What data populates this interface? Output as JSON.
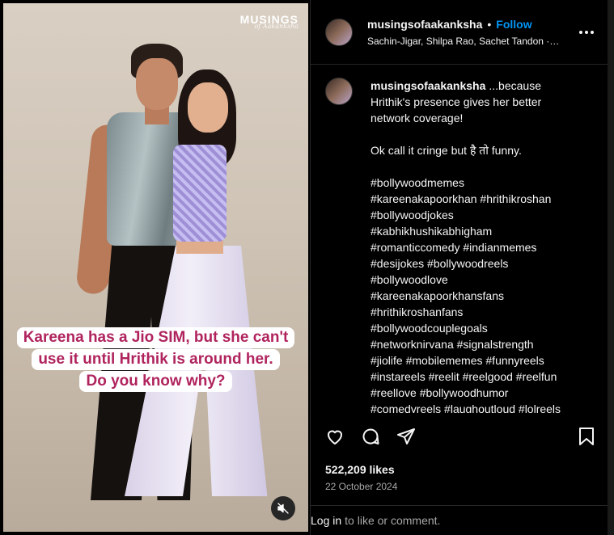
{
  "media": {
    "watermark_main": "MUSINGS",
    "watermark_sub": "of Aakanksha",
    "caption_lines": [
      "Kareena has a Jio SIM, but she can't",
      "use it until Hrithik is around her.",
      "Do you know why?"
    ],
    "mute_icon": "speaker-muted-icon"
  },
  "header": {
    "username": "musingsofaakanksha",
    "separator": "•",
    "follow_label": "Follow",
    "audio": "Sachin-Jigar, Shilpa Rao, Sachet Tandon · Bijli Bijli"
  },
  "post": {
    "username": "musingsofaakanksha",
    "caption_start": "...because",
    "lines": [
      "Hrithik's presence gives her better",
      "network coverage!",
      "",
      "Ok call it cringe but है तो funny.",
      "",
      "#bollywoodmemes",
      "#kareenakapoorkhan #hrithikroshan",
      "#bollywoodjokes",
      "#kabhikhushikabhigham",
      "#romanticcomedy #indianmemes",
      "#desijokes #bollywoodreels",
      "#bollywoodlove",
      "#kareenakapoorkhansfans",
      "#hrithikroshanfans",
      "#bollywoodcouplegoals",
      "#networknirvana #signalstrength",
      "#jiolife #mobilememes #funnyreels",
      "#instareels #reelit #reelgood #reelfun",
      "#reellove #bollywoodhumor",
      "#comedyreels #laughoutloud #lolreels"
    ]
  },
  "stats": {
    "likes": "522,209 likes",
    "date": "22 October 2024"
  },
  "login": {
    "link": "Log in",
    "rest": "to like or comment."
  },
  "colors": {
    "accent": "#0095f6",
    "caption_text": "#b0245e",
    "background": "#000000"
  }
}
